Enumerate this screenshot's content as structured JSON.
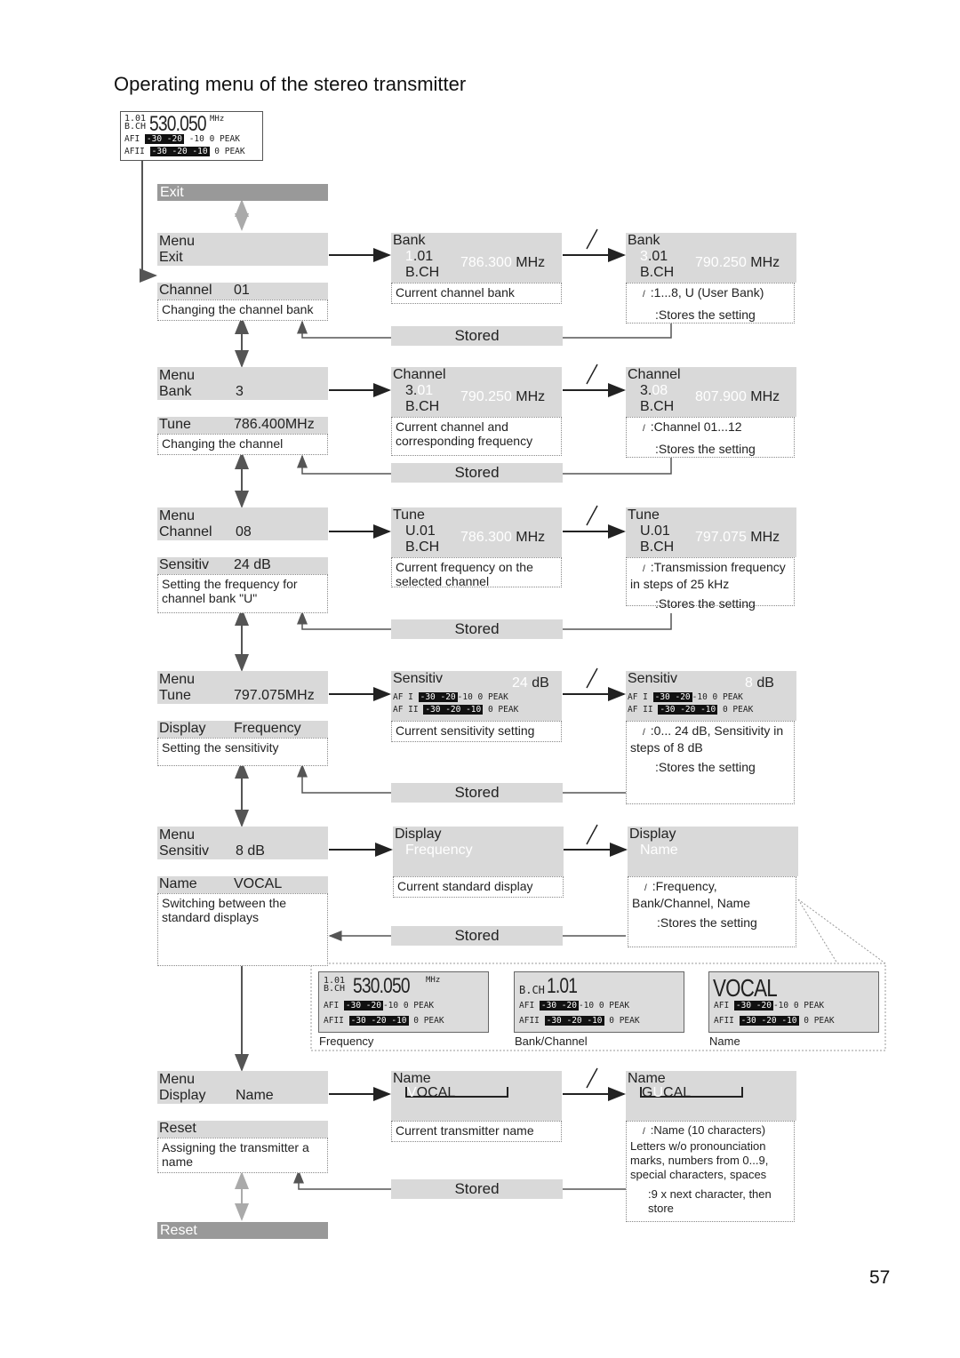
{
  "page": {
    "title": "Operating menu of the stereo transmitter",
    "page_number": "57"
  },
  "top_display": {
    "bch_top": "1.01",
    "bch_bottom": "B.CH",
    "frequency": "530.050",
    "unit": "MHz",
    "af1_label": "AFI",
    "af2_label": "AFII",
    "meter1": "-30 -20",
    "meter1_rest": "-10",
    "meter2": "-30 -20 -10",
    "peak": "0 PEAK"
  },
  "exit_bar": "Exit",
  "reset_bar": "Reset",
  "stored_label": "Stored",
  "rows": [
    {
      "menu_label": "Menu",
      "menu_item": "Exit",
      "menu_value": "",
      "next_item": "Channel",
      "next_value": "01",
      "description": "Changing the channel bank",
      "current": {
        "title": "Bank",
        "code_hi": "1",
        "code_rest": ".01",
        "bch": "B.CH",
        "freq": "786.300",
        "unit": "MHz",
        "description": "Current channel bank"
      },
      "edit": {
        "title": "Bank",
        "code_hi": "3",
        "code_rest": ".01",
        "bch": "B.CH",
        "freq": "790.250",
        "unit": "MHz",
        "line1": ":1...8, U (User Bank)",
        "line2": ":Stores the setting"
      }
    },
    {
      "menu_label": "Menu",
      "menu_item": "Bank",
      "menu_value": "3",
      "next_item": "Tune",
      "next_value": "786.400MHz",
      "description": "Changing the channel",
      "current": {
        "title": "Channel",
        "code_hi": "3.",
        "code_rest": "01",
        "bch": "B.CH",
        "freq": "790.250",
        "unit": "MHz",
        "description": "Current channel and corresponding frequency"
      },
      "edit": {
        "title": "Channel",
        "code_hi": "3.",
        "code_rest": "08",
        "bch": "B.CH",
        "freq": "807.900",
        "unit": "MHz",
        "line1": ":Channel  01...12",
        "line2": ":Stores the setting"
      }
    },
    {
      "menu_label": "Menu",
      "menu_item": "Channel",
      "menu_value": "08",
      "next_item": "Sensitiv",
      "next_value": "24 dB",
      "description": "Setting the frequency for channel bank \"U\"",
      "current": {
        "title": "Tune",
        "code_hi": "U.01",
        "code_rest": "",
        "bch": "B.CH",
        "freq": "786.300",
        "unit": "MHz",
        "description": "Current frequency on the selected channel"
      },
      "edit": {
        "title": "Tune",
        "code_hi": "U.01",
        "code_rest": "",
        "bch": "B.CH",
        "freq": "797.075",
        "unit": "MHz",
        "line1": ":Transmission frequency in steps of 25 kHz",
        "line2": ":Stores the setting"
      }
    },
    {
      "menu_label": "Menu",
      "menu_item": "Tune",
      "menu_value": "797.075MHz",
      "next_item": "Display",
      "next_value": "Frequency",
      "description": "Setting the sensitivity",
      "current": {
        "title": "Sensitiv",
        "value": "24",
        "unit": "dB",
        "description": "Current sensitivity setting"
      },
      "edit": {
        "title": "Sensitiv",
        "value": "8",
        "unit": "dB",
        "line1": ":0... 24 dB, Sensitivity in steps of 8 dB",
        "line2": ":Stores the setting"
      }
    },
    {
      "menu_label": "Menu",
      "menu_item": "Sensitiv",
      "menu_value": "8 dB",
      "next_item": "Name",
      "next_value": "VOCAL",
      "description": "Switching between the standard displays",
      "current": {
        "title": "Display",
        "value": "Frequency",
        "description": "Current standard display"
      },
      "edit": {
        "title": "Display",
        "value": "Name",
        "line1": ":Frequency, Bank/Channel, Name",
        "line2": ":Stores the setting"
      }
    },
    {
      "menu_label": "Menu",
      "menu_item": "Display",
      "menu_value": "Name",
      "next_item": "Reset",
      "next_value": "",
      "description": "Assigning the transmitter a name",
      "current": {
        "title": "Name",
        "cursor_char": "V",
        "rest": "OCAL",
        "description": "Current transmitter name"
      },
      "edit": {
        "title": "Name",
        "pre": "G",
        "cursor_char": "U",
        "rest": "CAL",
        "line1": ":Name (10 characters) Letters  w/o pronounciation marks, numbers from 0...9, special characters, spaces",
        "line2": ":9 x next character, then store"
      }
    }
  ],
  "display_modes": [
    {
      "caption": "Frequency",
      "bch_top": "1.01",
      "bch_bottom": "B.CH",
      "main": "530.050",
      "unit": "MHz"
    },
    {
      "caption": "Bank/Channel",
      "bch_bottom": "B.CH",
      "main": "1.01"
    },
    {
      "caption": "Name",
      "main": "VOCAL"
    }
  ],
  "slash_glyph": "/"
}
